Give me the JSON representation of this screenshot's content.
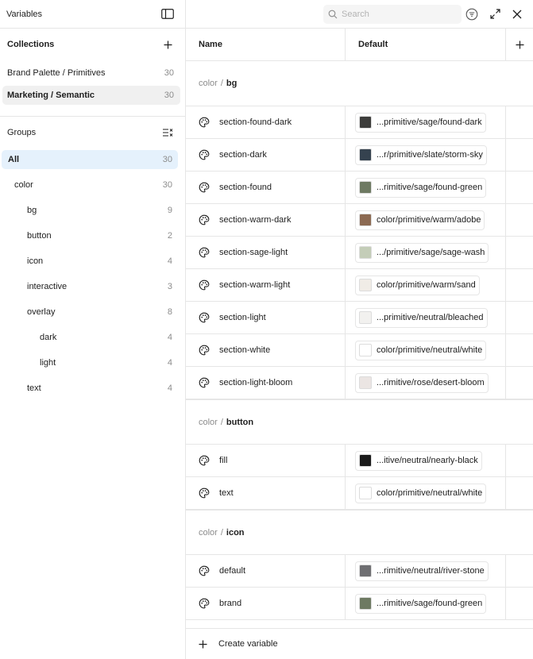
{
  "sidebar": {
    "title": "Variables",
    "collections_label": "Collections",
    "collections": [
      {
        "name": "Brand Palette / Primitives",
        "count": "30",
        "active": false
      },
      {
        "name": "Marketing / Semantic",
        "count": "30",
        "active": true
      }
    ],
    "groups_label": "Groups",
    "groups": [
      {
        "name": "All",
        "count": "30",
        "level": 0,
        "active": true
      },
      {
        "name": "color",
        "count": "30",
        "level": 1,
        "active": false
      },
      {
        "name": "bg",
        "count": "9",
        "level": 2,
        "active": false
      },
      {
        "name": "button",
        "count": "2",
        "level": 2,
        "active": false
      },
      {
        "name": "icon",
        "count": "4",
        "level": 2,
        "active": false
      },
      {
        "name": "interactive",
        "count": "3",
        "level": 2,
        "active": false
      },
      {
        "name": "overlay",
        "count": "8",
        "level": 2,
        "active": false
      },
      {
        "name": "dark",
        "count": "4",
        "level": 3,
        "active": false
      },
      {
        "name": "light",
        "count": "4",
        "level": 3,
        "active": false
      },
      {
        "name": "text",
        "count": "4",
        "level": 2,
        "active": false
      }
    ]
  },
  "toolbar": {
    "search_placeholder": "Search"
  },
  "table": {
    "col_name": "Name",
    "col_default": "Default",
    "groups": [
      {
        "prefix": "color",
        "separator": "/",
        "name": "bg",
        "rows": [
          {
            "name": "section-found-dark",
            "value": "...primitive/sage/found-dark",
            "color": "#3d3d3b"
          },
          {
            "name": "section-dark",
            "value": "...r/primitive/slate/storm-sky",
            "color": "#35424f"
          },
          {
            "name": "section-found",
            "value": "...rimitive/sage/found-green",
            "color": "#6e7a62"
          },
          {
            "name": "section-warm-dark",
            "value": "color/primitive/warm/adobe",
            "color": "#8c6a52"
          },
          {
            "name": "section-sage-light",
            "value": ".../primitive/sage/sage-wash",
            "color": "#c4cdb8"
          },
          {
            "name": "section-warm-light",
            "value": "color/primitive/warm/sand",
            "color": "#f0ece6"
          },
          {
            "name": "section-light",
            "value": "...primitive/neutral/bleached",
            "color": "#f2f1ef"
          },
          {
            "name": "section-white",
            "value": "color/primitive/neutral/white",
            "color": "#ffffff"
          },
          {
            "name": "section-light-bloom",
            "value": "...rimitive/rose/desert-bloom",
            "color": "#ebe5e3"
          }
        ]
      },
      {
        "prefix": "color",
        "separator": "/",
        "name": "button",
        "rows": [
          {
            "name": "fill",
            "value": "...itive/neutral/nearly-black",
            "color": "#1a1a1a"
          },
          {
            "name": "text",
            "value": "color/primitive/neutral/white",
            "color": "#ffffff"
          }
        ]
      },
      {
        "prefix": "color",
        "separator": "/",
        "name": "icon",
        "rows": [
          {
            "name": "default",
            "value": "...rimitive/neutral/river-stone",
            "color": "#6f6f72"
          },
          {
            "name": "brand",
            "value": "...rimitive/sage/found-green",
            "color": "#6e7a62"
          }
        ]
      }
    ]
  },
  "footer": {
    "create_label": "Create variable"
  }
}
